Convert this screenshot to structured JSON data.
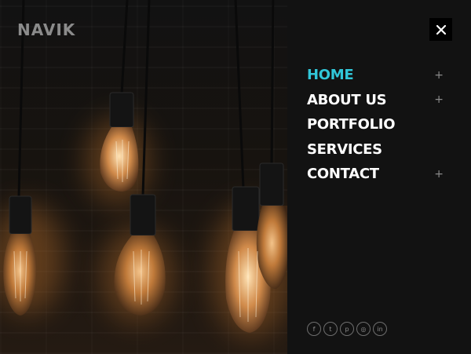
{
  "brand": {
    "logo_text": "NAVIK"
  },
  "hero": {
    "image_alt": "hanging-edison-light-bulbs"
  },
  "close": {
    "label": "×",
    "icon": "close-icon"
  },
  "menu": {
    "items": [
      {
        "label": "HOME",
        "active": true,
        "has_submenu": true,
        "expander": "+"
      },
      {
        "label": "ABOUT US",
        "active": false,
        "has_submenu": true,
        "expander": "+"
      },
      {
        "label": "PORTFOLIO",
        "active": false,
        "has_submenu": false,
        "expander": ""
      },
      {
        "label": "SERVICES",
        "active": false,
        "has_submenu": false,
        "expander": ""
      },
      {
        "label": "CONTACT",
        "active": false,
        "has_submenu": true,
        "expander": "+"
      }
    ]
  },
  "social": [
    {
      "icon": "facebook-icon",
      "glyph": "f"
    },
    {
      "icon": "twitter-icon",
      "glyph": "t"
    },
    {
      "icon": "pinterest-icon",
      "glyph": "p"
    },
    {
      "icon": "instagram-icon",
      "glyph": "◎"
    },
    {
      "icon": "linkedin-icon",
      "glyph": "in"
    }
  ],
  "colors": {
    "accent": "#31c6d8",
    "panel_bg": "#121212",
    "text": "#ffffff",
    "muted": "#8a8a8a"
  }
}
